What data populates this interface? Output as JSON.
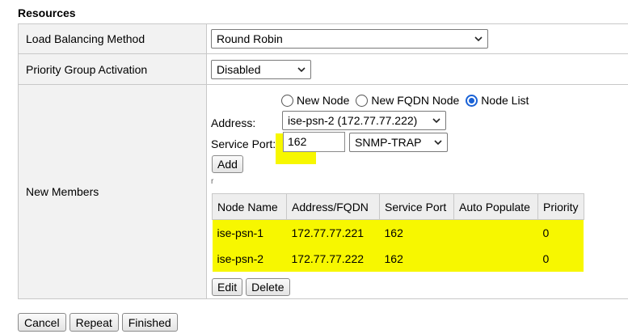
{
  "section_title": "Resources",
  "rows": {
    "lb_method": {
      "label": "Load Balancing Method",
      "value": "Round Robin"
    },
    "pga": {
      "label": "Priority Group Activation",
      "value": "Disabled"
    },
    "new_members": {
      "label": "New Members"
    }
  },
  "radios": [
    {
      "label": "New Node",
      "checked": false
    },
    {
      "label": "New FQDN Node",
      "checked": false
    },
    {
      "label": "Node List",
      "checked": true
    }
  ],
  "address": {
    "label": "Address:",
    "value": "ise-psn-2 (172.77.77.222)"
  },
  "service_port": {
    "label": "Service Port:",
    "value": "162",
    "service": "SNMP-TRAP"
  },
  "add_label": "Add",
  "tick": "r",
  "members_table": {
    "headers": [
      "Node Name",
      "Address/FQDN",
      "Service Port",
      "Auto Populate",
      "Priority"
    ],
    "rows": [
      [
        "ise-psn-1",
        "172.77.77.221",
        "162",
        "",
        "0"
      ],
      [
        "ise-psn-2",
        "172.77.77.222",
        "162",
        "",
        "0"
      ]
    ]
  },
  "edit_label": "Edit",
  "delete_label": "Delete",
  "footer": {
    "cancel": "Cancel",
    "repeat": "Repeat",
    "finished": "Finished"
  },
  "colors": {
    "highlight": "#f7f700",
    "radio_selected": "#1a62d6",
    "label_bg": "#f2f2f2"
  }
}
